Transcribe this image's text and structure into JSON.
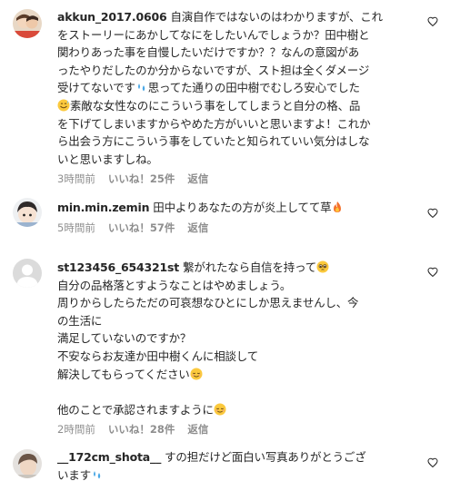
{
  "comments": [
    {
      "username": "akkun_2017.0606",
      "lines": [
        "自演自作ではないのはわかりますが、これ",
        "をストーリーにあかしてなにをしたいんでしょうか？田中樹と",
        "関わりあった事を自慢したいだけですか？？なんの意図があ",
        "ったやりだしたのか分からないですが、スト担は全くダメージ",
        "受けてないです",
        "思ってた通りの田中樹でむしろ安心でした",
        "素敵な女性なのにこういう事をしてしまうと自分の格、品",
        "を下げてしまいますからやめた方がいいと思いますよ！これか",
        "ら出会う方にこういう事をしていたと知られていい気分はしな",
        "いと思いますしね。"
      ],
      "time": "3時間前",
      "likes": "いいね！25件",
      "reply": "返信"
    },
    {
      "username": "min.min.zemin",
      "lines": [
        "田中よりあなたの方が炎上してて草"
      ],
      "time": "5時間前",
      "likes": "いいね！57件",
      "reply": "返信"
    },
    {
      "username": "st123456_654321st",
      "lines": [
        "繋がれたなら自信を持って",
        "自分の品格落とすようなことはやめましょう。",
        "周りからしたらただの可哀想なひとにしか思えませんし、今",
        "の生活に",
        "満足していないのですか？",
        "不安ならお友達か田中樹くんに相談して",
        "解決してもらってください",
        "",
        "他のことで承認されますように"
      ],
      "time": "2時間前",
      "likes": "いいね！28件",
      "reply": "返信"
    },
    {
      "username": "__172cm_shota__",
      "lines": [
        "すの担だけど面白い写真ありがとうござ",
        "います"
      ],
      "time": "",
      "likes": "",
      "reply": ""
    }
  ],
  "icons": {
    "like": "heart-outline-icon",
    "avatar_placeholder": "default-avatar-icon"
  },
  "colors": {
    "text": "#262626",
    "meta": "#8e8e8e"
  }
}
